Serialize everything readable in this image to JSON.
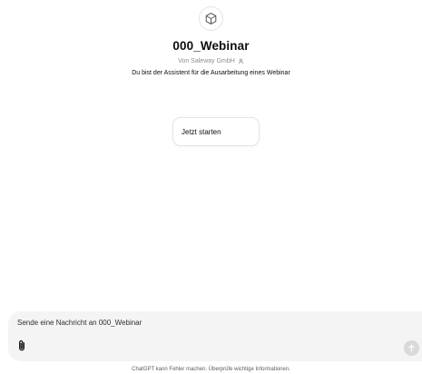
{
  "gpt": {
    "icon": "cube-icon",
    "title": "000_Webinar",
    "author": "Von Saleway GmbH",
    "author_icon": "person-icon",
    "description": "Du bist der Assistent für die Ausarbeitung eines Webinar"
  },
  "starters": [
    {
      "label": "Jetzt starten"
    }
  ],
  "composer": {
    "placeholder": "Sende eine Nachricht an 000_Webinar",
    "attach_icon": "paperclip-icon",
    "send_icon": "arrow-up-icon"
  },
  "footer": {
    "note": "ChatGPT kann Fehler machen. Überprüfe wichtige Informationen."
  },
  "colors": {
    "background": "#ffffff",
    "composer_bg": "#f4f4f4",
    "send_disabled": "#d9d9d9",
    "muted_text": "#8e8e8e"
  }
}
